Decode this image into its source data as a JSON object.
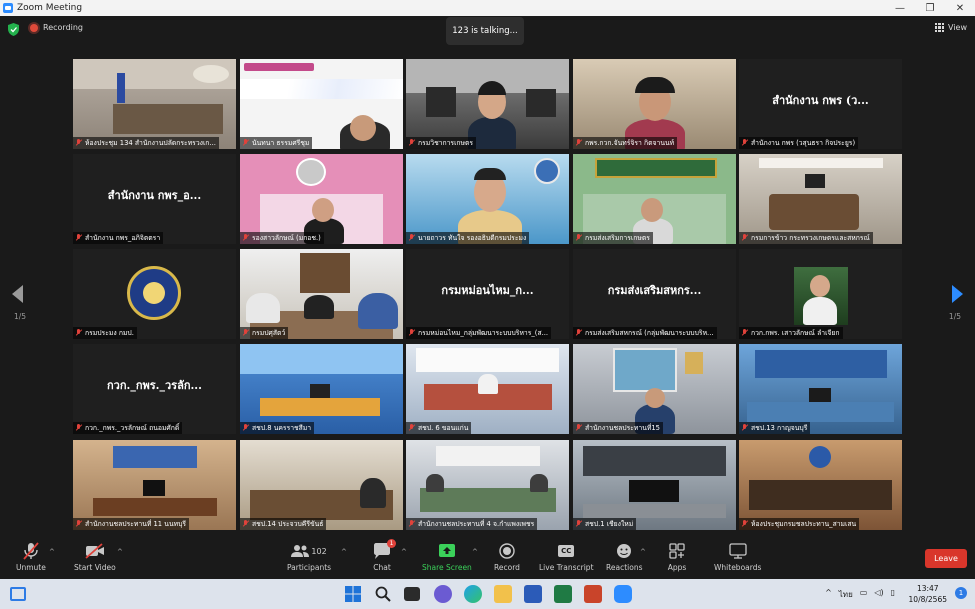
{
  "window": {
    "title": "Zoom Meeting"
  },
  "meeting": {
    "recording_label": "Recording",
    "talking_label": "123 is talking...",
    "view_label": "View"
  },
  "pager": {
    "left": "1/5",
    "right": "1/5"
  },
  "tiles": [
    {
      "name": "ห้องประชุม 134 สำนักงานปลัดกระทรวงเก..."
    },
    {
      "name": "นันทนา ธรรมศรีชุม"
    },
    {
      "name": "กรมวิชาการเกษตร"
    },
    {
      "name": "กพร.กวก.จันทร์จิรา กิตจานนท์"
    },
    {
      "name": "สำนักงาน กพร (วสุนธรา กิจประยูร)",
      "big": "สำนักงาน กพร (ว..."
    },
    {
      "name": "สำนักงาน กพร_อภิจิตตรา",
      "big": "สำนักงาน กพร_อ..."
    },
    {
      "name": "รองสาวลักษณ์ (มกอช.)"
    },
    {
      "name": "นายถาวร ทันใจ รองอธิบดีกรมประมง"
    },
    {
      "name": "กรมส่งเสริมการเกษตร"
    },
    {
      "name": "กรมการข้าว กระทรวงเกษตรและสหกรณ์"
    },
    {
      "name": "กรมประมง กมป."
    },
    {
      "name": "กรมปศุสัตว์"
    },
    {
      "name": "กรมหม่อนไหม_กลุ่มพัฒนาระบบบริหาร_(ส...",
      "big": "กรมหม่อนไหม_ก..."
    },
    {
      "name": "กรมส่งเสริมสหกรณ์ (กลุ่มพัฒนาระบบบริห...",
      "big": "กรมส่งเสริมสหกร..."
    },
    {
      "name": "กวก.กพร. เสาวลักษณ์ ลำเจียก"
    },
    {
      "name": "กวก._กพร._วรลักษณ์ ถนอมศักดิ์",
      "big": "กวก._กพร._วรลัก..."
    },
    {
      "name": "สชป.8 นครราชสีมา"
    },
    {
      "name": "สชป. 6 ขอนแก่น"
    },
    {
      "name": "สำนักงานชลประทานที่15"
    },
    {
      "name": "สชป.13 กาญจนบุรี"
    },
    {
      "name": "สำนักงานชลประทานที่ 11 นนทบุรี"
    },
    {
      "name": "สชป.14 ประจวบคีรีขันธ์"
    },
    {
      "name": "สำนักงานชลประทานที่ 4 จ.กำแพงเพชร"
    },
    {
      "name": "สชป.1 เชียงใหม่"
    },
    {
      "name": "ห้องประชุมกรมชลประทาน_สามเสน"
    }
  ],
  "toolbar": {
    "unmute": "Unmute",
    "start_video": "Start Video",
    "participants": "Participants",
    "participants_count": "102",
    "chat": "Chat",
    "chat_badge": "1",
    "share_screen": "Share Screen",
    "record": "Record",
    "live_transcript": "Live Transcript",
    "cc": "CC",
    "reactions": "Reactions",
    "apps": "Apps",
    "whiteboards": "Whiteboards",
    "leave": "Leave"
  },
  "taskbar": {
    "lang": "ไทย",
    "time": "13:47",
    "date": "10/8/2565",
    "notifications": "1"
  },
  "colors": {
    "accent": "#2d8cff",
    "leave": "#d9362b",
    "share": "#3bd15a",
    "muted": "#e0423b"
  }
}
